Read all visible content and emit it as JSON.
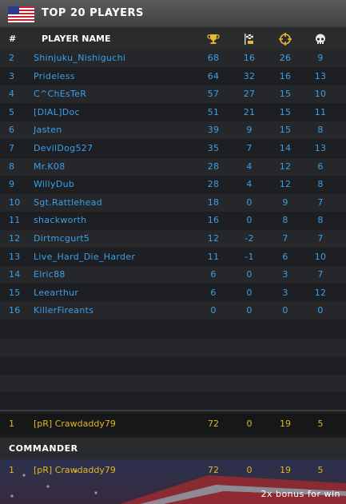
{
  "header": {
    "title": "TOP 20 PLAYERS",
    "flag_icon": "us-flag-icon"
  },
  "columns": {
    "rank": "#",
    "name": "PLAYER NAME",
    "icons": [
      "trophy-icon",
      "flag-capture-icon",
      "crosshair-icon",
      "skull-icon"
    ]
  },
  "players": [
    {
      "rank": "2",
      "name": "Shinjuku_Nishiguchi",
      "score": "68",
      "c2": "16",
      "c3": "26",
      "c4": "9"
    },
    {
      "rank": "3",
      "name": "Prideless",
      "score": "64",
      "c2": "32",
      "c3": "16",
      "c4": "13"
    },
    {
      "rank": "4",
      "name": "C^ChEsTeR",
      "score": "57",
      "c2": "27",
      "c3": "15",
      "c4": "10"
    },
    {
      "rank": "5",
      "name": "[DIAL]Doc",
      "score": "51",
      "c2": "21",
      "c3": "15",
      "c4": "11"
    },
    {
      "rank": "6",
      "name": "Jasten",
      "score": "39",
      "c2": "9",
      "c3": "15",
      "c4": "8"
    },
    {
      "rank": "7",
      "name": "DevilDog527",
      "score": "35",
      "c2": "7",
      "c3": "14",
      "c4": "13"
    },
    {
      "rank": "8",
      "name": "Mr.K08",
      "score": "28",
      "c2": "4",
      "c3": "12",
      "c4": "6"
    },
    {
      "rank": "9",
      "name": "WillyDub",
      "score": "28",
      "c2": "4",
      "c3": "12",
      "c4": "8"
    },
    {
      "rank": "10",
      "name": "Sgt.Rattlehead",
      "score": "18",
      "c2": "0",
      "c3": "9",
      "c4": "7"
    },
    {
      "rank": "11",
      "name": "shackworth",
      "score": "16",
      "c2": "0",
      "c3": "8",
      "c4": "8"
    },
    {
      "rank": "12",
      "name": "Dirtmcgurt5",
      "score": "12",
      "c2": "-2",
      "c3": "7",
      "c4": "7"
    },
    {
      "rank": "13",
      "name": "Live_Hard_Die_Harder",
      "score": "11",
      "c2": "-1",
      "c3": "6",
      "c4": "10"
    },
    {
      "rank": "14",
      "name": "Elric88",
      "score": "6",
      "c2": "0",
      "c3": "3",
      "c4": "7"
    },
    {
      "rank": "15",
      "name": "Leearthur",
      "score": "6",
      "c2": "0",
      "c3": "3",
      "c4": "12"
    },
    {
      "rank": "16",
      "name": "KillerFireants",
      "score": "0",
      "c2": "0",
      "c3": "0",
      "c4": "0"
    }
  ],
  "current_player": {
    "rank": "1",
    "name": "[pR] Crawdaddy79",
    "score": "72",
    "c2": "0",
    "c3": "19",
    "c4": "5"
  },
  "commander": {
    "heading": "COMMANDER",
    "rank": "1",
    "name": "[pR] Crawdaddy79",
    "score": "72",
    "c2": "0",
    "c3": "19",
    "c4": "5",
    "bonus": "2x bonus for win"
  },
  "colors": {
    "player_text": "#3aa0e8",
    "highlight_text": "#e0b820"
  }
}
